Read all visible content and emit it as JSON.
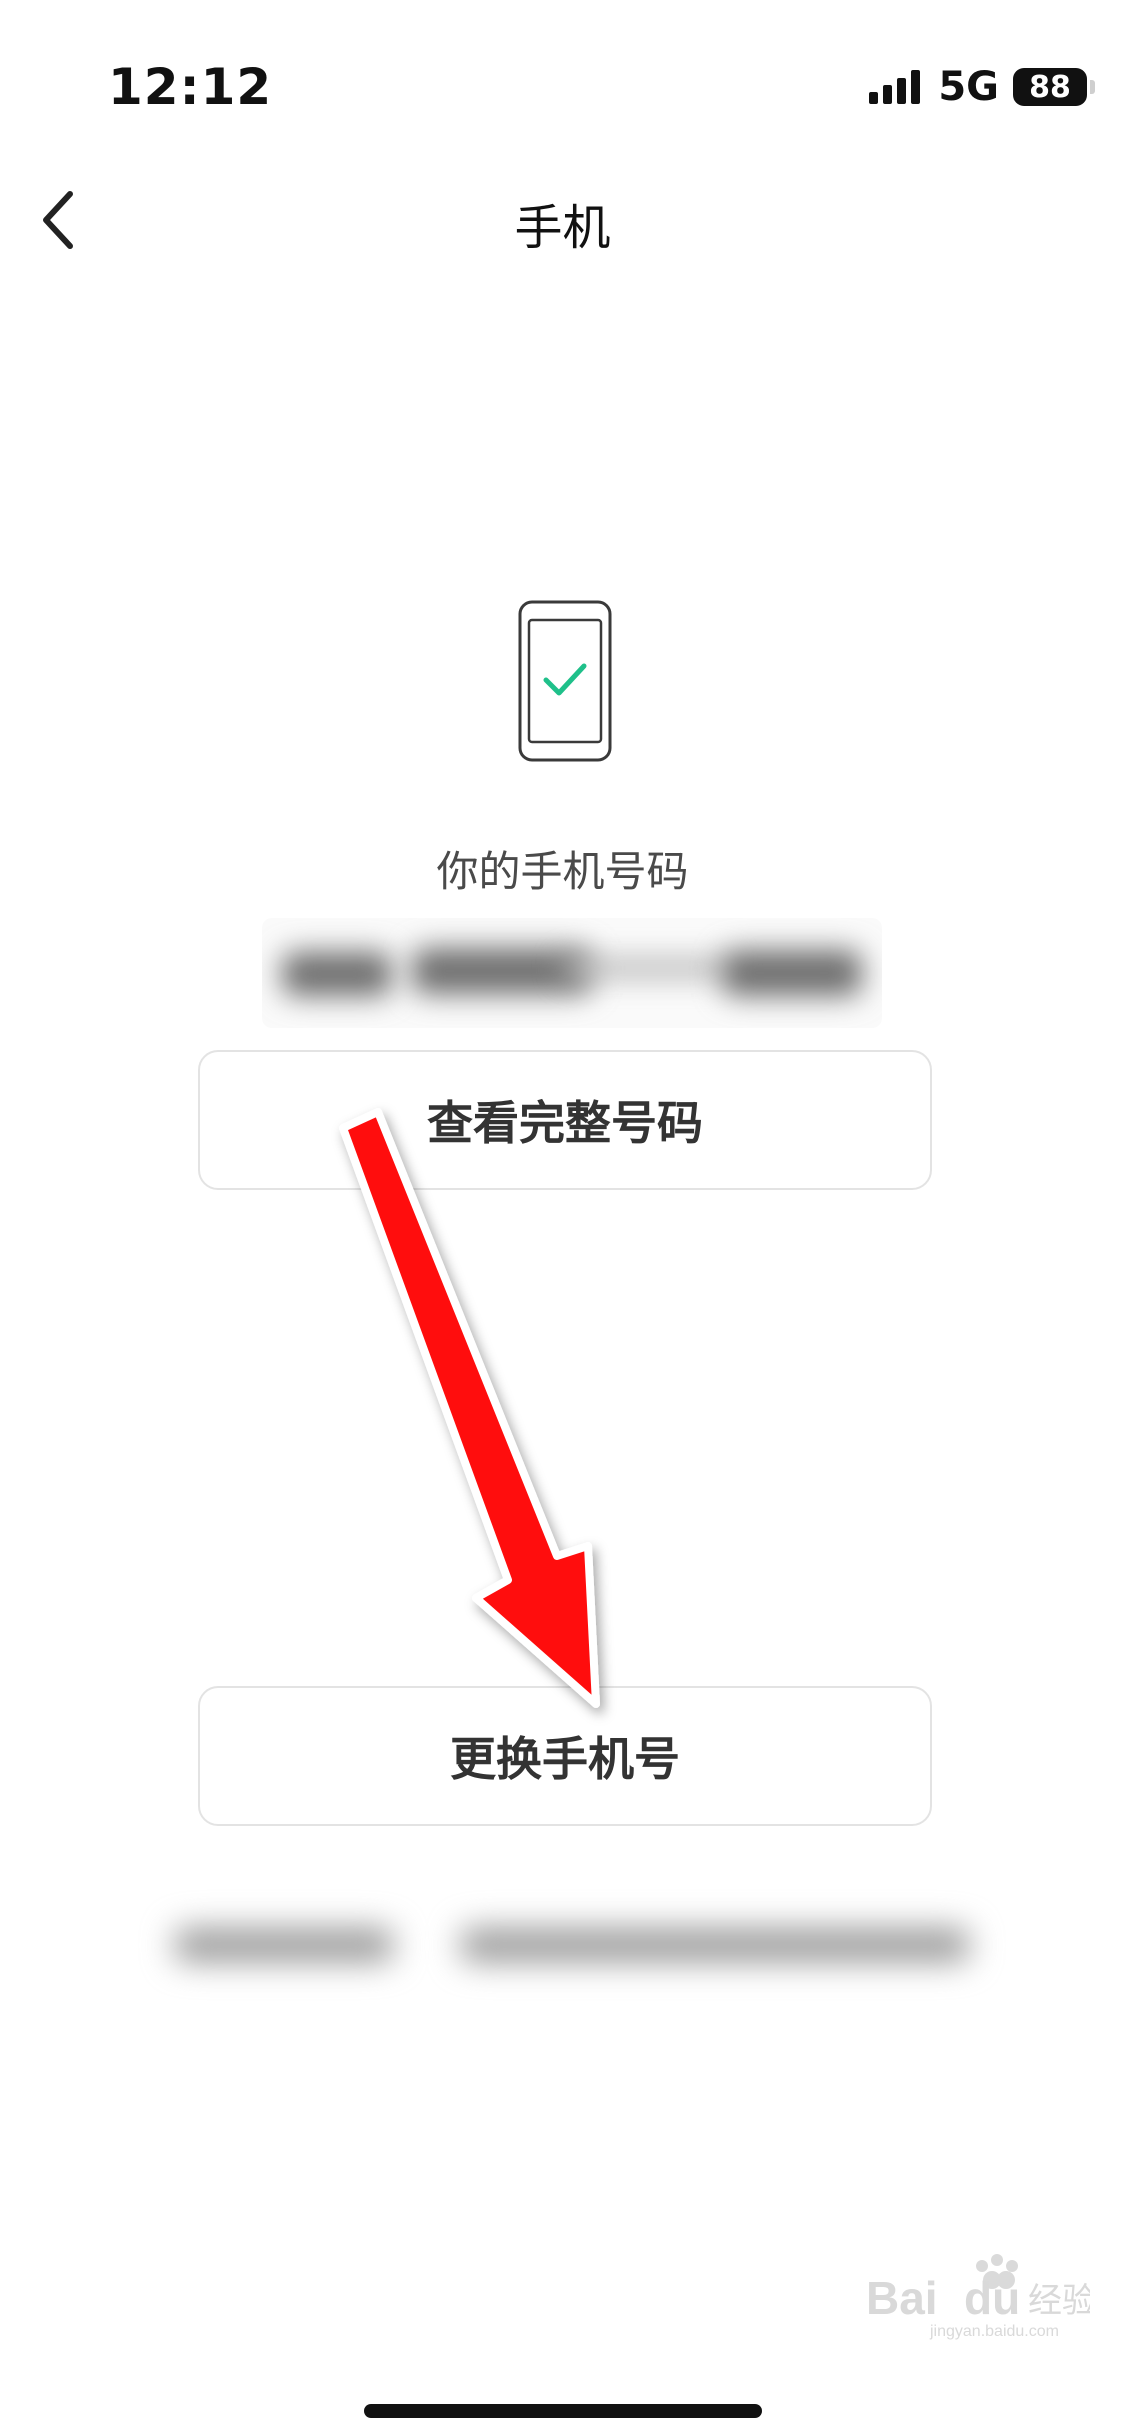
{
  "status_bar": {
    "time": "12:12",
    "network": "5G",
    "battery": "88",
    "signal_bars": 4
  },
  "nav": {
    "title": "手机",
    "back_icon": "chevron-left-icon"
  },
  "content": {
    "illustration_icon": "phone-check-icon",
    "number_label": "你的手机号码",
    "view_full_label": "查看完整号码",
    "change_number_label": "更换手机号"
  },
  "colors": {
    "check": "#1fc08a",
    "arrow": "#ff1010",
    "home_indicator": "#111111"
  }
}
